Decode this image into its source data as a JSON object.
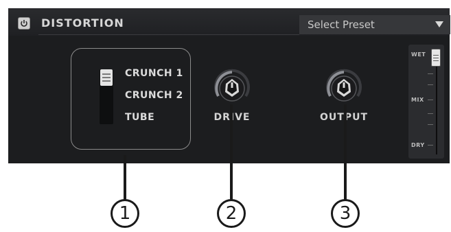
{
  "plugin": {
    "title": "DISTORTION",
    "preset": {
      "label": "Select Preset"
    },
    "mode": {
      "options": [
        "CRUNCH 1",
        "CRUNCH 2",
        "TUBE"
      ],
      "selected": "CRUNCH 1"
    },
    "knobs": {
      "drive": {
        "label": "DRIVE"
      },
      "output": {
        "label": "OUTPUT"
      }
    },
    "mix": {
      "wet_label": "WET",
      "mix_label": "MIX",
      "dry_label": "DRY",
      "level": 1.0
    }
  },
  "callouts": [
    {
      "number": "1"
    },
    {
      "number": "2"
    },
    {
      "number": "3"
    }
  ],
  "colors": {
    "panel": "#1c1d1f",
    "header": "#2a2b2e",
    "text": "#d7d7d7",
    "box_border": "#8c8c8c"
  }
}
